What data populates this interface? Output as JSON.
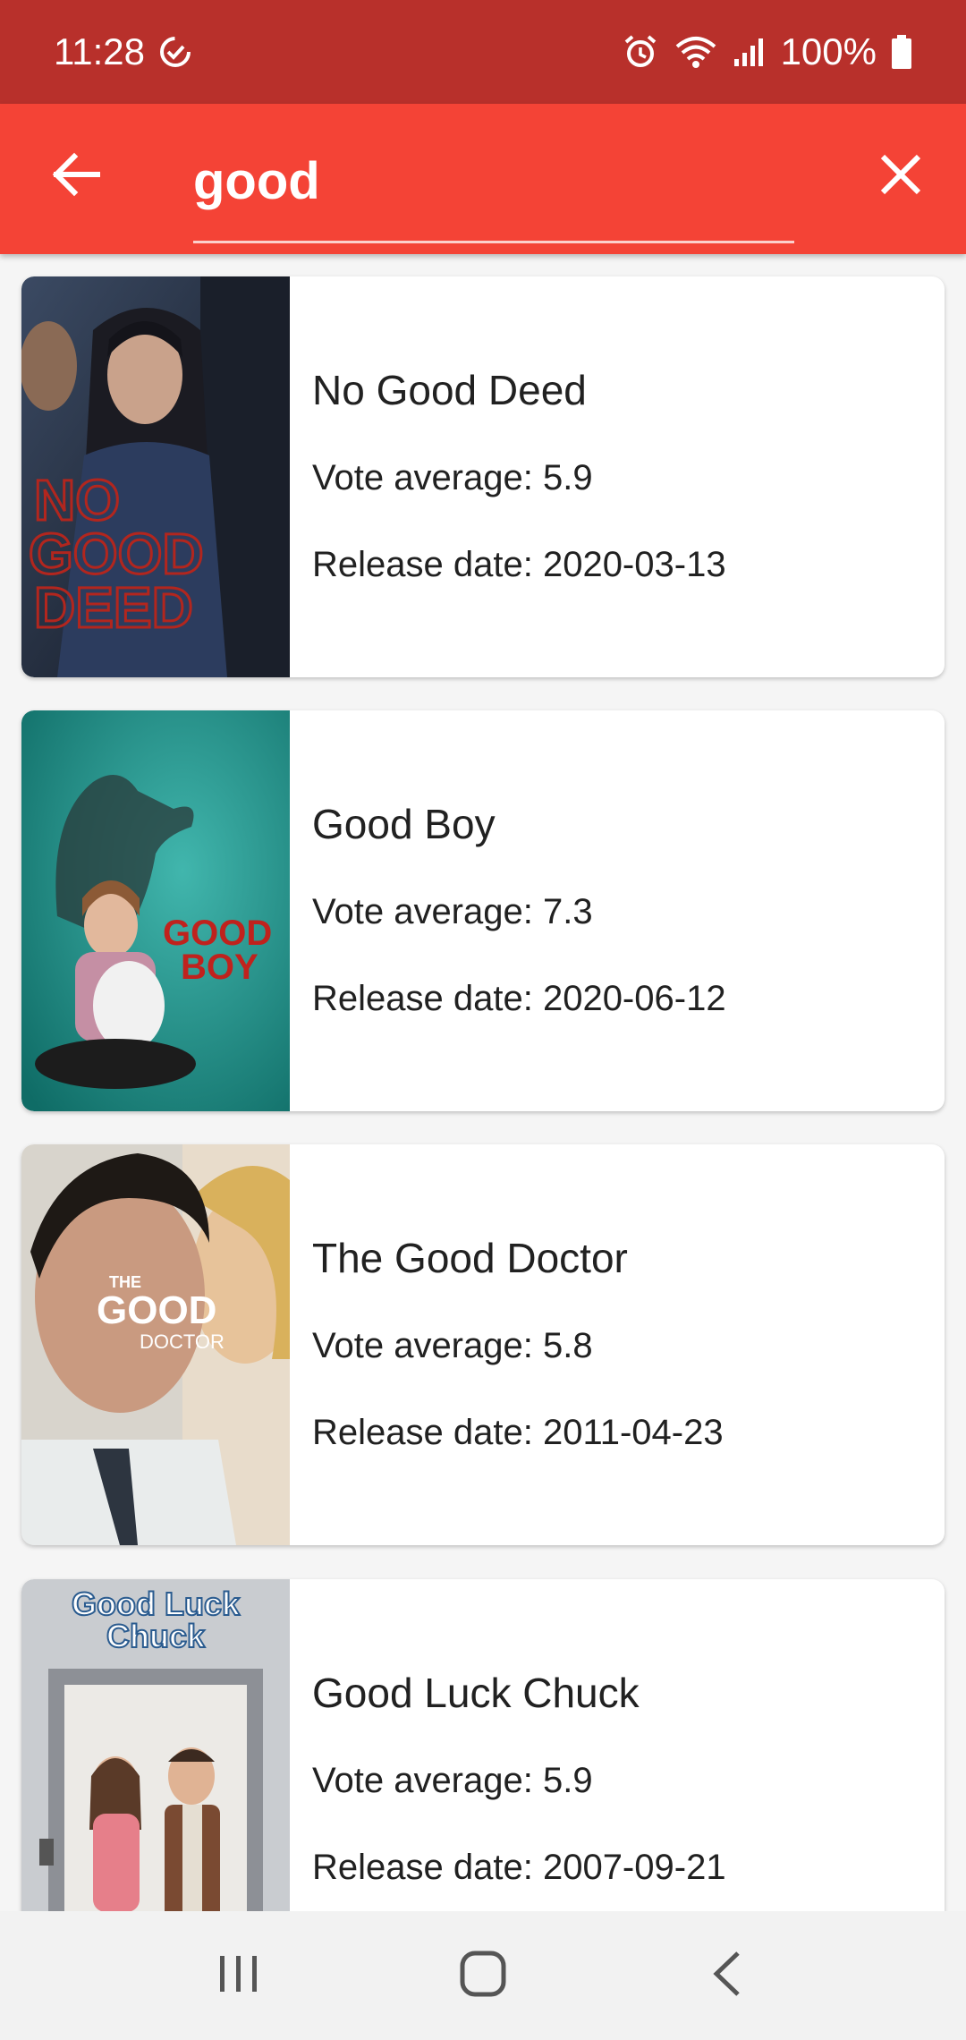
{
  "status_bar": {
    "time": "11:28",
    "battery": "100%"
  },
  "search": {
    "value": "good",
    "back_icon": "arrow-left-icon",
    "clear_icon": "close-icon"
  },
  "results": [
    {
      "title": "No Good Deed",
      "vote": "Vote average: 5.9",
      "release": "Release date: 2020-03-13",
      "poster_text": [
        "NO",
        "GOOD",
        "DEED"
      ]
    },
    {
      "title": "Good Boy",
      "vote": "Vote average: 7.3",
      "release": "Release date: 2020-06-12",
      "poster_text": [
        "GOOD",
        "BOY"
      ]
    },
    {
      "title": "The Good Doctor",
      "vote": "Vote average: 5.8",
      "release": "Release date: 2011-04-23",
      "poster_text": [
        "THE",
        "GOOD",
        "DOCTOR"
      ]
    },
    {
      "title": "Good Luck Chuck",
      "vote": "Vote average: 5.9",
      "release": "Release date: 2007-09-21",
      "poster_text": [
        "Good Luck",
        "Chuck"
      ]
    }
  ],
  "colors": {
    "status_bar": "#b8302b",
    "app_bar": "#f44336"
  }
}
